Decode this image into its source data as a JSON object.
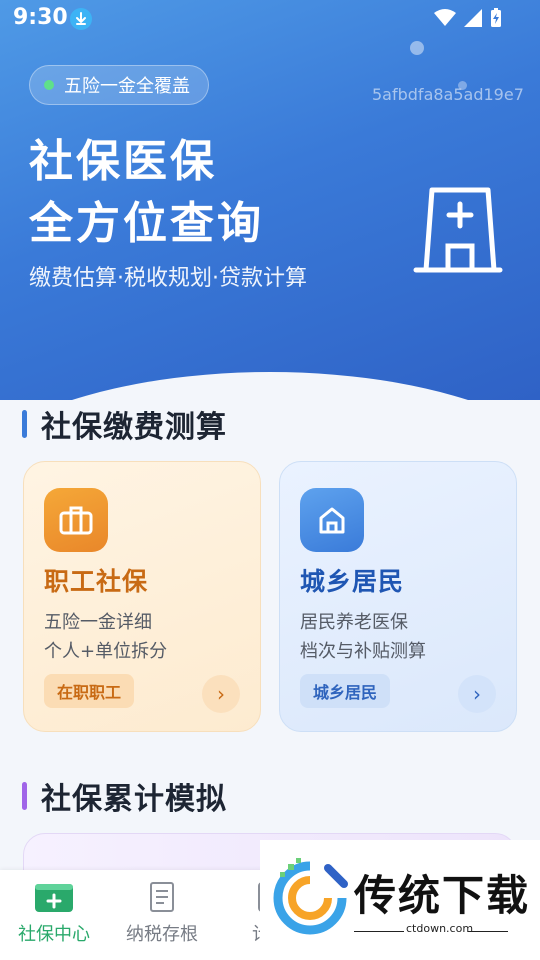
{
  "status": {
    "time": "9:30"
  },
  "hero": {
    "tag": "五险一金全覆盖",
    "hash": "5afbdfa8a5ad19e7",
    "title_line1": "社保医保",
    "title_line2": "全方位查询",
    "subtitle": "缴费估算·税收规划·贷款计算"
  },
  "sections": {
    "calc_title": "社保缴费测算",
    "sim_title": "社保累计模拟"
  },
  "cards": [
    {
      "title": "职工社保",
      "line1": "五险一金详细",
      "line2": "个人+单位拆分",
      "chip": "在职职工",
      "arrow": "›"
    },
    {
      "title": "城乡居民",
      "line1": "居民养老医保",
      "line2": "档次与补贴测算",
      "chip": "城乡居民",
      "arrow": "›"
    }
  ],
  "tabs": [
    {
      "label": "社保中心"
    },
    {
      "label": "纳税存根"
    },
    {
      "label": "计算"
    }
  ],
  "watermark": {
    "brand": "传统下载",
    "url": "ctdown.com"
  },
  "colors": {
    "hero_start": "#4f9ae6",
    "hero_end": "#2f62c6",
    "accent_green": "#2aa96b",
    "orange": "#e9872a",
    "blue": "#3a7bd9",
    "purple": "#a065e8"
  }
}
